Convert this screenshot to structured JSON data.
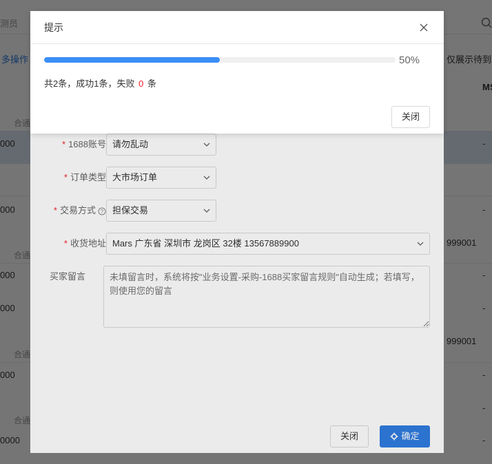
{
  "background": {
    "top_left_frag": "测员",
    "batch_ops": "多操作",
    "top_right_frag": "仅展示待到",
    "col_header_frag": "MS",
    "col_prefix": "合通",
    "amount_frag": "000",
    "amount_frag_b": "0000",
    "phone_frag": "999001",
    "dash": "-"
  },
  "form_dialog": {
    "account_label": "1688账号",
    "account_value": "请勿乱动",
    "order_type_label": "订单类型",
    "order_type_value": "大市场订单",
    "trade_label": "交易方式",
    "trade_value": "担保交易",
    "address_label": "收货地址",
    "address_value": "Mars 广东省 深圳市 龙岗区 32楼 13567889900",
    "message_label": "买家留言",
    "message_placeholder": "未填留言时，系统将按\"业务设置-采购-1688买家留言规则\"自动生成；若填写，则使用您的留言",
    "close_label": "关闭",
    "ok_label": "确定"
  },
  "progress_dialog": {
    "title": "提示",
    "percent_text": "50%",
    "percent": 50,
    "summary_prefix": "共2条，成功1条，失败",
    "fail_count": "0",
    "summary_suffix": "条",
    "close_label": "关闭"
  },
  "colors": {
    "progress_fill": "#3a8ef6",
    "primary": "#2f7de1",
    "danger": "#f5222d"
  }
}
